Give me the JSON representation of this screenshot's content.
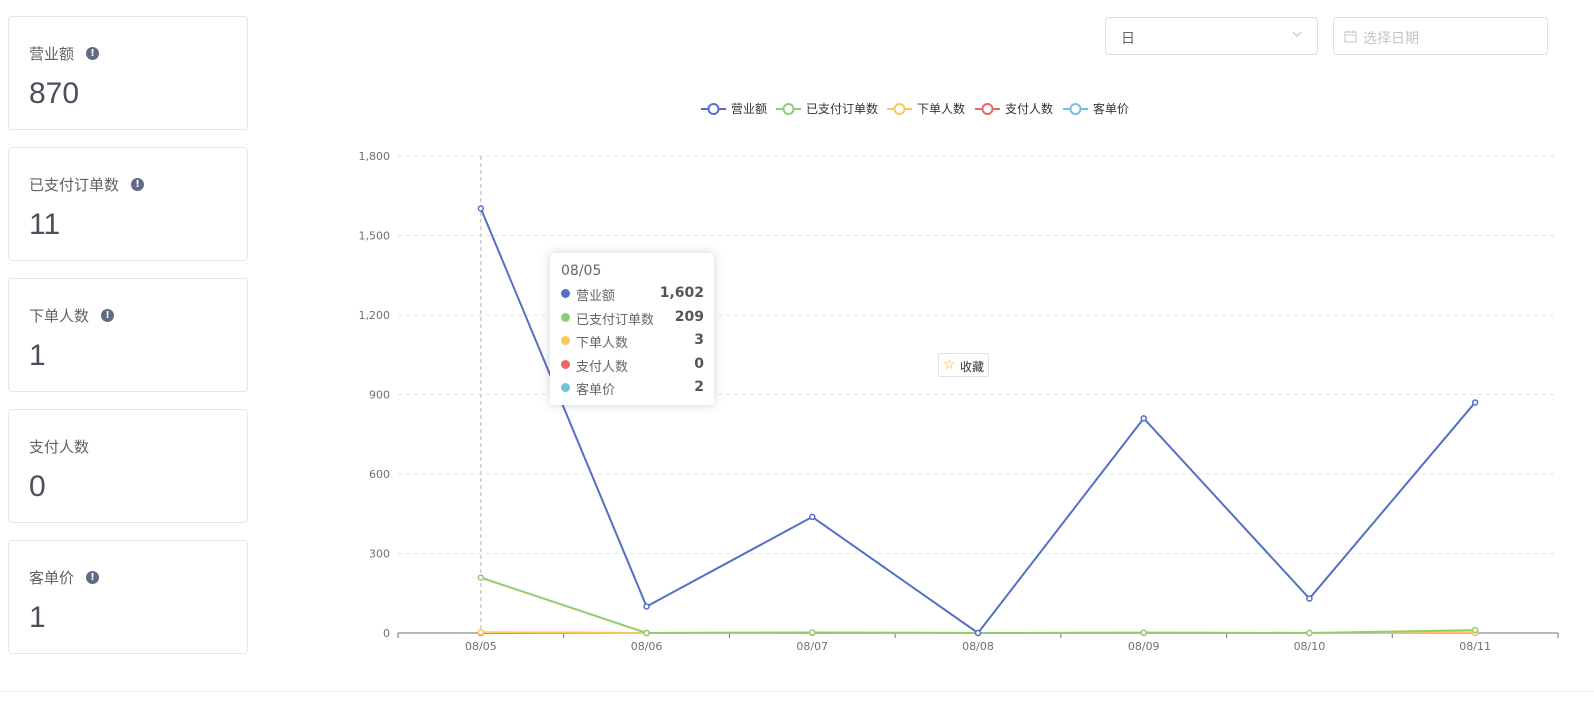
{
  "cards": [
    {
      "label": "营业额",
      "value": "870",
      "info": true
    },
    {
      "label": "已支付订单数",
      "value": "11",
      "info": true
    },
    {
      "label": "下单人数",
      "value": "1",
      "info": true
    },
    {
      "label": "支付人数",
      "value": "0",
      "info": false
    },
    {
      "label": "客单价",
      "value": "1",
      "info": true
    }
  ],
  "filters": {
    "period_value": "日",
    "date_placeholder": "选择日期"
  },
  "favorite_label": "收藏",
  "tooltip": {
    "title": "08/05",
    "rows": [
      {
        "name": "营业额",
        "value": "1,602",
        "color": "#5470c6"
      },
      {
        "name": "已支付订单数",
        "value": "209",
        "color": "#91cc75"
      },
      {
        "name": "下单人数",
        "value": "3",
        "color": "#fac858"
      },
      {
        "name": "支付人数",
        "value": "0",
        "color": "#ee6666"
      },
      {
        "name": "客单价",
        "value": "2",
        "color": "#73c0de"
      }
    ]
  },
  "chart_data": {
    "type": "line",
    "x": [
      "08/05",
      "08/06",
      "08/07",
      "08/08",
      "08/09",
      "08/10",
      "08/11"
    ],
    "ylim": [
      0,
      1800
    ],
    "yticks": [
      0,
      300,
      600,
      900,
      1200,
      1500,
      1800
    ],
    "ytick_labels": [
      "0",
      "300",
      "600",
      "900",
      "1,200",
      "1,500",
      "1,800"
    ],
    "grid": true,
    "legend_position": "top-center",
    "series": [
      {
        "name": "营业额",
        "color": "#5470c6",
        "values": [
          1602,
          100,
          438,
          0,
          810,
          130,
          870
        ]
      },
      {
        "name": "已支付订单数",
        "color": "#91cc75",
        "values": [
          209,
          0,
          2,
          0,
          1,
          0,
          11
        ]
      },
      {
        "name": "下单人数",
        "color": "#fac858",
        "values": [
          3,
          0,
          1,
          0,
          1,
          0,
          1
        ]
      },
      {
        "name": "支付人数",
        "color": "#ee6666",
        "values": [
          0,
          0,
          0,
          0,
          0,
          0,
          0
        ]
      },
      {
        "name": "客单价",
        "color": "#73c0de",
        "values": [
          2,
          0,
          1,
          0,
          1,
          0,
          1
        ]
      }
    ]
  }
}
